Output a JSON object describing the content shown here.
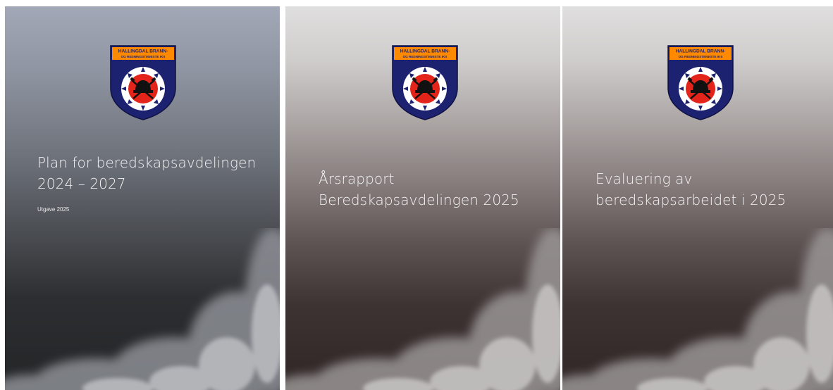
{
  "logo": {
    "line1": "HALLINGDAL BRANN-",
    "line2": "OG REDNINGSTENESTE IKS",
    "icon": "fire-service-crest-icon",
    "colors": {
      "shield": "#1d2270",
      "banner": "#ff8a00",
      "banner_text": "#1d2270",
      "ring": "#ffffff",
      "center": "#e3241b"
    }
  },
  "covers": [
    {
      "title_lines": [
        "Plan for beredskapsavdelingen",
        "2024 – 2027"
      ],
      "edition": "Utgave 2025"
    },
    {
      "title_lines": [
        "Årsrapport",
        "Beredskapsavdelingen 2025"
      ]
    },
    {
      "title_lines": [
        "Evaluering av",
        "beredskapsarbeidet i 2025"
      ]
    }
  ]
}
